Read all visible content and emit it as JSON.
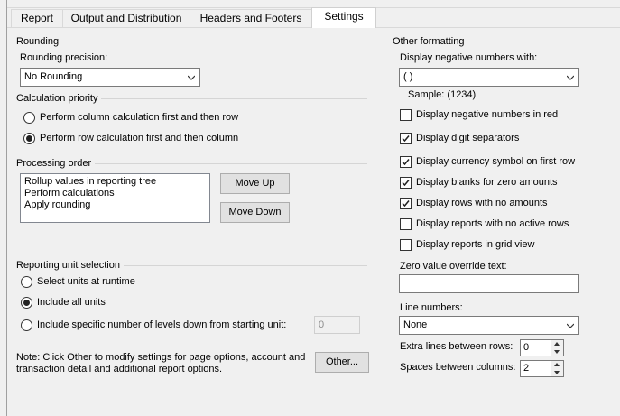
{
  "tabs": [
    {
      "label": "Report",
      "active": false
    },
    {
      "label": "Output and Distribution",
      "active": false
    },
    {
      "label": "Headers and Footers",
      "active": false
    },
    {
      "label": "Settings",
      "active": true
    }
  ],
  "rounding": {
    "group_label": "Rounding",
    "precision_label": "Rounding precision:",
    "precision_value": "No Rounding"
  },
  "calculation": {
    "group_label": "Calculation priority",
    "options": [
      {
        "label": "Perform column calculation first and then row",
        "selected": false
      },
      {
        "label": "Perform row calculation first and then column",
        "selected": true
      }
    ]
  },
  "processing": {
    "group_label": "Processing order",
    "items": [
      "Rollup values in reporting tree",
      "Perform calculations",
      "Apply rounding"
    ],
    "move_up": "Move Up",
    "move_down": "Move Down"
  },
  "reporting_unit": {
    "group_label": "Reporting unit selection",
    "options": [
      {
        "label": "Select units at runtime",
        "selected": false
      },
      {
        "label": "Include all units",
        "selected": true
      },
      {
        "label": "Include specific number of levels down from starting unit:",
        "selected": false
      }
    ],
    "levels_value": "0"
  },
  "note": {
    "text1": "Note: Click Other to modify settings for page options, account and",
    "text2": "transaction detail and additional report options.",
    "other_button": "Other..."
  },
  "other_formatting": {
    "group_label": "Other formatting",
    "negative_label": "Display negative numbers with:",
    "negative_value": "( )",
    "sample": "Sample: (1234)",
    "checkboxes": [
      {
        "label": "Display negative numbers in red",
        "checked": false
      },
      {
        "label": "Display digit separators",
        "checked": true
      },
      {
        "label": "Display currency symbol on first row",
        "checked": true
      },
      {
        "label": "Display blanks for zero amounts",
        "checked": true
      },
      {
        "label": "Display rows with no amounts",
        "checked": true
      },
      {
        "label": "Display reports with no active rows",
        "checked": false
      },
      {
        "label": "Display reports in grid view",
        "checked": false
      }
    ],
    "zero_override_label": "Zero value override text:",
    "zero_override_value": "",
    "line_numbers_label": "Line numbers:",
    "line_numbers_value": "None",
    "extra_lines_label": "Extra lines between rows:",
    "extra_lines_value": "0",
    "spaces_label": "Spaces between columns:",
    "spaces_value": "2"
  }
}
